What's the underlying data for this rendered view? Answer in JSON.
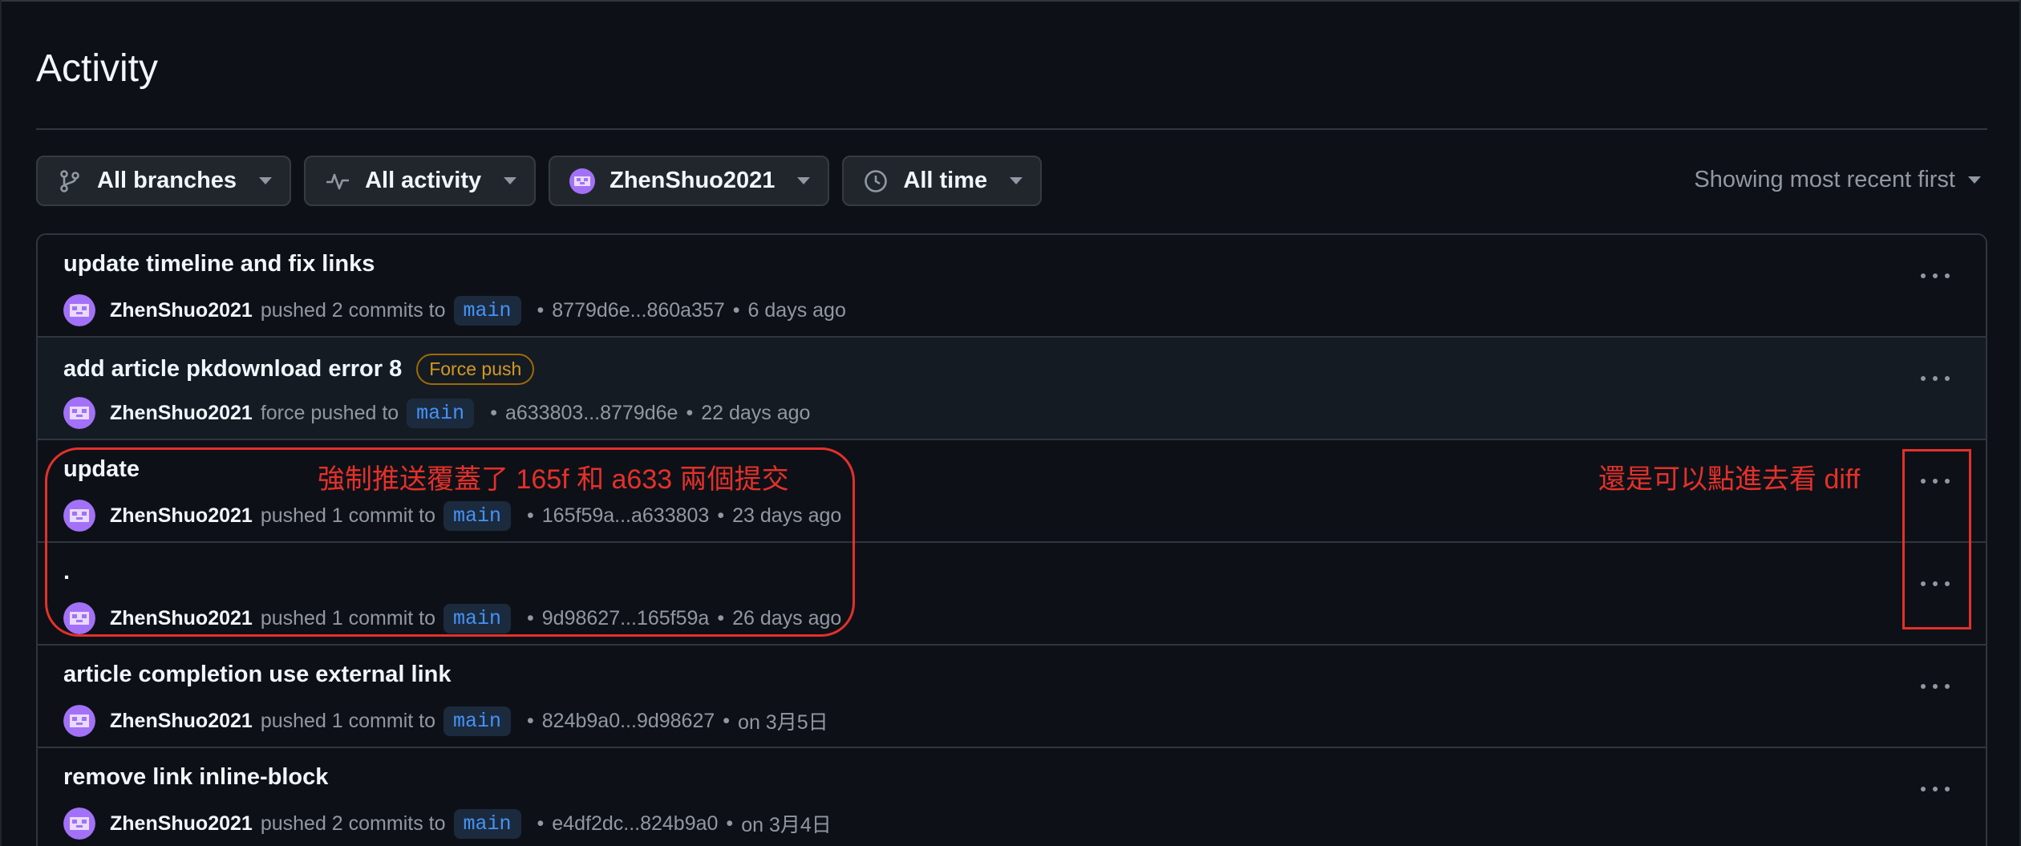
{
  "page": {
    "title": "Activity"
  },
  "filters": {
    "branches": "All branches",
    "activity": "All activity",
    "user": "ZhenShuo2021",
    "time": "All time"
  },
  "sort": {
    "label": "Showing most recent first"
  },
  "items": [
    {
      "title": "update timeline and fix links",
      "user": "ZhenShuo2021",
      "action": "pushed 2 commits to",
      "branch": "main",
      "range": "8779d6e...860a357",
      "time": "6 days ago",
      "badge": ""
    },
    {
      "title": "add article pkdownload error 8",
      "user": "ZhenShuo2021",
      "action": "force pushed to",
      "branch": "main",
      "range": "a633803...8779d6e",
      "time": "22 days ago",
      "badge": "Force push"
    },
    {
      "title": "update",
      "user": "ZhenShuo2021",
      "action": "pushed 1 commit to",
      "branch": "main",
      "range": "165f59a...a633803",
      "time": "23 days ago",
      "badge": ""
    },
    {
      "title": ".",
      "user": "ZhenShuo2021",
      "action": "pushed 1 commit to",
      "branch": "main",
      "range": "9d98627...165f59a",
      "time": "26 days ago",
      "badge": ""
    },
    {
      "title": "article completion use external link",
      "user": "ZhenShuo2021",
      "action": "pushed 1 commit to",
      "branch": "main",
      "range": "824b9a0...9d98627",
      "time": "on 3月5日",
      "badge": ""
    },
    {
      "title": "remove link inline-block",
      "user": "ZhenShuo2021",
      "action": "pushed 2 commits to",
      "branch": "main",
      "range": "e4df2dc...824b9a0",
      "time": "on 3月4日",
      "badge": ""
    }
  ],
  "annotations": {
    "left": "強制推送覆蓋了 165f 和 a633 兩個提交",
    "right": "還是可以點進去看 diff",
    "color": "#e5302a"
  },
  "colors": {
    "background": "#0d1117",
    "branch_text": "#4493f8",
    "badge": "#d29922"
  }
}
